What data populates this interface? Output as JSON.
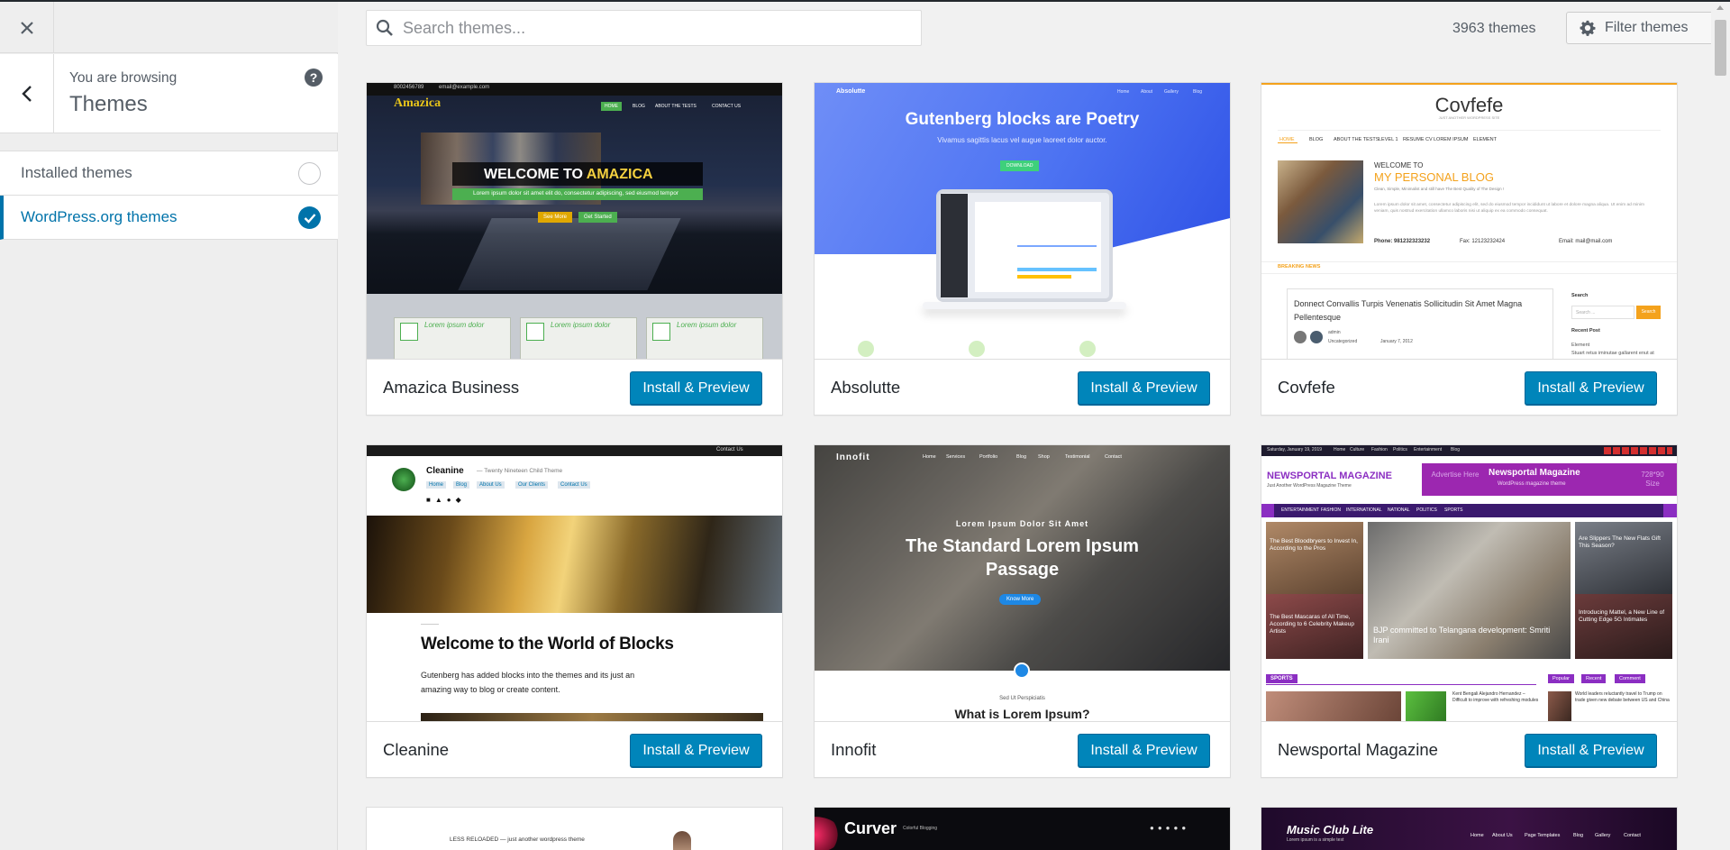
{
  "sidebar": {
    "close_label": "Close",
    "back_label": "Back",
    "browsing_label": "You are browsing",
    "browsing_title": "Themes",
    "help_label": "?",
    "sections": [
      {
        "label": "Installed themes",
        "checked": false
      },
      {
        "label": "WordPress.org themes",
        "checked": true
      }
    ]
  },
  "toolbar": {
    "search_placeholder": "Search themes...",
    "search_value": "",
    "theme_count": "3963 themes",
    "filter_label": "Filter themes"
  },
  "install_label": "Install & Preview",
  "colors": {
    "accent": "#0073aa",
    "button": "#0085ba",
    "button_border": "#006799"
  },
  "themes": [
    {
      "name": "Amazica Business",
      "preview": {
        "topbar_phone": "8002456789",
        "topbar_email": "email@example.com",
        "logo": "Amazica",
        "nav": [
          "HOME",
          "BLOG",
          "ABOUT THE TESTS",
          "CONTACT US"
        ],
        "hero_prefix": "WELCOME TO ",
        "hero_highlight": "AMAZICA",
        "hero_sub": "Lorem ipsum dolor sit amet elit do, consectetur adipiscing, sed eiusmod tempor",
        "btn1": "See More",
        "btn2": "Get Started",
        "features": [
          "Lorem ipsum dolor",
          "Lorem ipsum dolor",
          "Lorem ipsum dolor"
        ]
      }
    },
    {
      "name": "Absolutte",
      "preview": {
        "logo": "Absolutte",
        "nav": [
          "Home",
          "About",
          "Gallery",
          "Blog"
        ],
        "headline": "Gutenberg blocks are Poetry",
        "sub": "Vivamus sagittis lacus vel augue laoreet dolor auctor.",
        "cta": "DOWNLOAD"
      }
    },
    {
      "name": "Covfefe",
      "preview": {
        "logo": "Covfefe",
        "tagline": "JUST ANOTHER WORDPRESS SITE",
        "nav": [
          "HOME",
          "BLOG",
          "ABOUT THE TESTS",
          "LEVEL 1",
          "RESUME CV",
          "LOREM IPSUM",
          "ELEMENT"
        ],
        "welcome": "WELCOME TO",
        "title": "MY PERSONAL BLOG",
        "subtitle": "Clean, Simple, Minimalist and still have The Best Quality of The Design !",
        "body": "Lorem ipsum dolor sit amet, consectetur adipiscing elit, sed do eiusmod tempor incididunt ut labore et dolore magna aliqua. Ut enim ad minim veniam, quis nostrud exercitation ullamco laboris nisi ut aliquip ex ea commodo consequat.",
        "phone": "Phone: 981232323232",
        "fax": "Fax: 12123232424",
        "email": "Email: mail@mail.com",
        "breaking": "BREAKING NEWS",
        "post_title": "Donnect Convallis Turpis Venenatis Sollicitudin Sit Amet Magna Pellentesque",
        "post_author": "admin",
        "post_cat": "Uncategorized",
        "post_date": "January 7, 2012",
        "search_label": "Search",
        "search_placeholder": "Search ...",
        "search_btn": "Search",
        "recent": "Recent Post",
        "recent_item": "Element",
        "recent_item2": "Stuart retus iminutae gallarent enut at"
      }
    },
    {
      "name": "Cleanine",
      "preview": {
        "contact": "Contact Us",
        "site": "Cleanine",
        "site_desc": "— Twenty Nineteen Child Theme",
        "nav": [
          "Home",
          "Blog",
          "About Us",
          "Our Clients",
          "Contact Us"
        ],
        "headline": "Welcome to the World of Blocks",
        "text1": "Gutenberg has added blocks into the themes and its just an",
        "text2": "amazing way to blog or create content."
      }
    },
    {
      "name": "Innofit",
      "preview": {
        "logo": "Innofit",
        "nav": [
          "Home",
          "Services",
          "Portfolio",
          "Blog",
          "Shop",
          "Testimonial",
          "Contact"
        ],
        "kicker": "Lorem Ipsum Dolor Sit Amet",
        "headline1": "The Standard Lorem Ipsum",
        "headline2": "Passage",
        "cta": "Know More",
        "small": "Sed Ut Perspiciatis",
        "section": "What is Lorem Ipsum?"
      }
    },
    {
      "name": "Newsportal Magazine",
      "preview": {
        "date": "Saturday, January 19, 2019",
        "nav_top": [
          "Home",
          "Culture",
          "Fashion",
          "Politics",
          "Entertainment",
          "Blog"
        ],
        "logo": "NEWSPORTAL MAGAZINE",
        "logo_sub": "Just Another WordPress Magazine Theme",
        "ad1": "Advertise Here",
        "ad_title": "Newsportal Magazine",
        "ad_sub": "WordPress magazine theme",
        "ad_size": "728*90 Size",
        "nav": [
          "ENTERTAINMENT",
          "FASHION",
          "INTERNATIONAL",
          "NATIONAL",
          "POLITICS",
          "SPORTS"
        ],
        "story1": "The Best Bloodbryers to Invest In, According to the Pros",
        "story2": "The Best Mascaras of All Time, According to 6 Celebrity Makeup Artists",
        "story_main": "BJP committed to Telangana development: Smriti Irani",
        "story3": "Are Slippers The New Flats Gift This Season?",
        "story4": "Introducing Mattel, a New Line of Cutting Edge 5G Intimates",
        "sports": "SPORTS",
        "tabs": [
          "Popular",
          "Recent",
          "Comment"
        ],
        "sport_story": "Kent Bengali Alejandro Hernandez – Difficult to improve with refreshing modules",
        "side_story": "World leaders reluctantly travel to Trump on trade given new debate between US and China"
      }
    },
    {
      "name": "",
      "preview": {
        "text": "LESS RELOADED — just another wordpress theme"
      }
    },
    {
      "name": "",
      "preview": {
        "logo": "Curver",
        "tagline": "Colorful Blogging"
      }
    },
    {
      "name": "",
      "preview": {
        "logo": "Music Club Lite",
        "tagline": "Lorem ipsum is a simple test",
        "nav": [
          "Home",
          "About Us",
          "Page Templates",
          "Blog",
          "Gallery",
          "Contact"
        ]
      }
    }
  ]
}
